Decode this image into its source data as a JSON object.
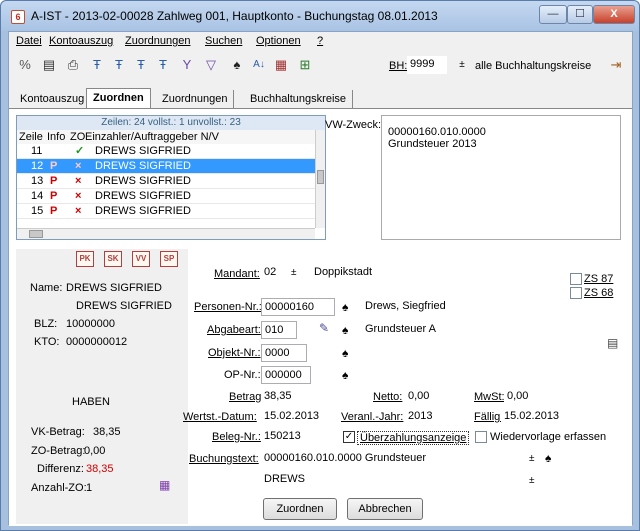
{
  "window": {
    "title": "A-IST - 2013-02-00028 Zahlweg 001, Hauptkonto - Buchungstag 08.01.2013",
    "app_icon": "6",
    "min": "—",
    "max": "☐",
    "close": "X"
  },
  "menu": [
    "Datei",
    "Kontoauszug",
    "Zuordnungen",
    "Suchen",
    "Optionen",
    "?"
  ],
  "toolbar": {
    "bh_label": "BH:",
    "bh_value": "9999",
    "kreise": "alle Buchhaltungskreise"
  },
  "tabs": [
    "Kontoauszug",
    "Zuordnen",
    "Zuordnungen",
    "Buchhaltungskreise"
  ],
  "list": {
    "summary": "Zeilen: 24 vollst.: 1 unvollst.: 23",
    "columns": [
      "Zeile",
      "Info",
      "ZO",
      "Einzahler/Auftraggeber N/V"
    ],
    "rows": [
      {
        "zeile": "11",
        "info": "",
        "zo": "✓",
        "name": "DREWS SIGFRIED"
      },
      {
        "zeile": "12",
        "info": "P",
        "zo": "×",
        "name": "DREWS SIGFRIED"
      },
      {
        "zeile": "13",
        "info": "P",
        "zo": "×",
        "name": "DREWS SIGFRIED"
      },
      {
        "zeile": "14",
        "info": "P",
        "zo": "×",
        "name": "DREWS SIGFRIED"
      },
      {
        "zeile": "15",
        "info": "P",
        "zo": "×",
        "name": "DREWS SIGFRIED"
      }
    ]
  },
  "vw": {
    "label": "VW-Zweck:",
    "text": "00000160.010.0000\nGrundsteuer 2013"
  },
  "leftpanel": {
    "buttons": [
      "PK",
      "SK",
      "VV",
      "SP"
    ],
    "name_label": "Name:",
    "name1": "DREWS SIGFRIED",
    "name2": "DREWS SIGFRIED",
    "blz_label": "BLZ:",
    "blz": "10000000",
    "kto_label": "KTO:",
    "kto": "0000000012",
    "haben": "HABEN",
    "vk_label": "VK-Betrag:",
    "vk": "38,35",
    "zo_label": "ZO-Betrag:",
    "zo": "0,00",
    "diff_label": "Differenz:",
    "diff": "38,35",
    "anzahl_label": "Anzahl-ZO:",
    "anzahl": "1"
  },
  "form": {
    "mandant_label": "Mandant:",
    "mandant": "02",
    "mandant_name": "Doppikstadt",
    "zs87": "ZS 87",
    "zs68": "ZS 68",
    "pers_label": "Personen-Nr.:",
    "pers": "00000160",
    "pers_name": "Drews, Siegfried",
    "abg_label": "Abgabeart:",
    "abg": "010",
    "abg_name": "Grundsteuer A",
    "obj_label": "Objekt-Nr.:",
    "obj": "0000",
    "op_label": "OP-Nr.:",
    "op": "000000",
    "betrag_label": "Betrag:",
    "betrag": "38,35",
    "netto_label": "Netto:",
    "netto": "0,00",
    "mwst_label": "MwSt:",
    "mwst": "0,00",
    "wert_label": "Wertst.-Datum:",
    "wert": "15.02.2013",
    "veranl_label": "Veranl.-Jahr:",
    "veranl": "2013",
    "faellig_label": "Fällig:",
    "faellig": "15.02.2013",
    "beleg_label": "Beleg-Nr.:",
    "beleg": "150213",
    "ueber_label": "Überzahlungsanzeige",
    "wieder_label": "Wiedervorlage erfassen",
    "btext_label": "Buchungstext:",
    "btext1": "00000160.010.0000 Grundsteuer",
    "btext2": "DREWS",
    "zuordnen": "Zuordnen",
    "abbrechen": "Abbrechen"
  }
}
